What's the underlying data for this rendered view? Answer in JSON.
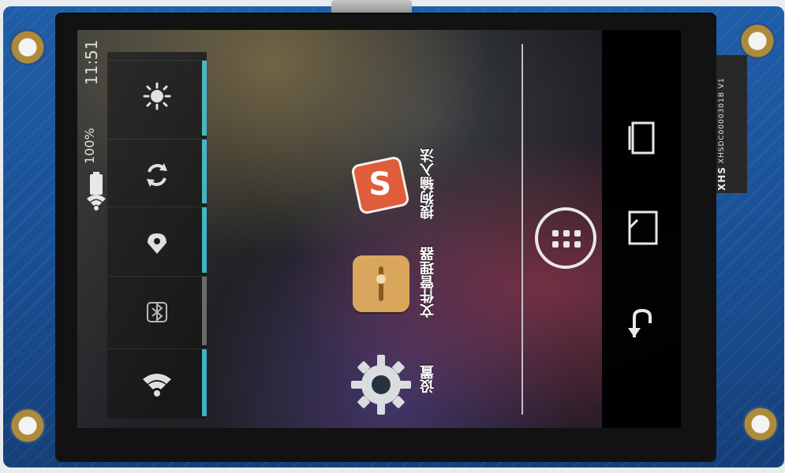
{
  "device": {
    "ribbon_label_lines": [
      "XHS",
      "XHSDC0000301B",
      "V1"
    ],
    "pcb_color": "#1a4f94"
  },
  "status_bar": {
    "time": "11:51",
    "battery": "100%",
    "icons": [
      "wifi-icon",
      "battery-icon"
    ]
  },
  "quick_settings": {
    "tiles": [
      {
        "icon": "brightness-icon"
      },
      {
        "icon": "auto-rotate-icon"
      },
      {
        "icon": "location-icon"
      },
      {
        "icon": "bluetooth-icon"
      },
      {
        "icon": "wifi-icon"
      }
    ],
    "accent": "#3fb6c7",
    "inactive": "#6a6a6a"
  },
  "apps": [
    {
      "label": "搜狗输入法",
      "icon": "sogou-input-icon"
    },
    {
      "label": "文件管理器",
      "icon": "file-manager-icon"
    },
    {
      "label": "设置",
      "icon": "settings-gear-icon"
    }
  ],
  "navigation": {
    "buttons": [
      "recent-apps",
      "home",
      "back"
    ],
    "launcher": "app-drawer"
  }
}
